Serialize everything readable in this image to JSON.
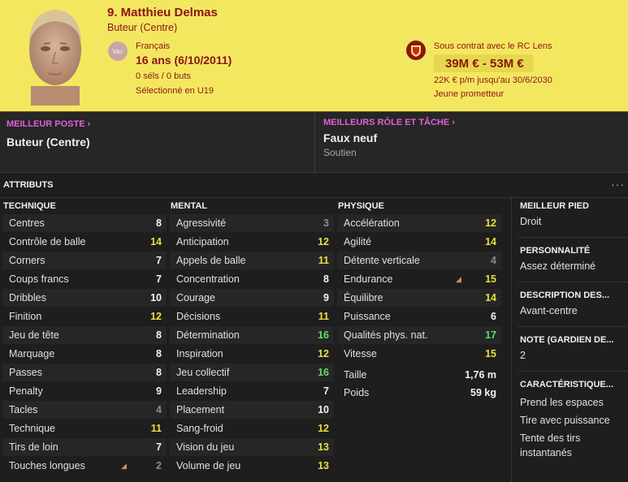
{
  "player": {
    "name": "9. Matthieu Delmas",
    "role": "Buteur (Centre)",
    "badge": "Vac",
    "nationality": "Français",
    "age": "16 ans (6/10/2011)",
    "caps": "0 séls / 0 buts",
    "youth": "Sélectionné en U19",
    "contract": "Sous contrat avec le RC Lens",
    "value": "39M € - 53M €",
    "wage": "22K € p/m jusqu'au 30/6/2030",
    "tag": "Jeune prometteur"
  },
  "best": {
    "pos_label": "MEILLEUR POSTE",
    "pos_value": "Buteur (Centre)",
    "role_label": "MEILLEURS RÔLE ET TÂCHE",
    "role_value": "Faux neuf",
    "role_duty": "Soutien"
  },
  "attributes": {
    "title": "ATTRIBUTS",
    "more": "···",
    "technique": {
      "header": "TECHNIQUE",
      "rows": [
        {
          "label": "Centres",
          "value": "8"
        },
        {
          "label": "Contrôle de balle",
          "value": "14"
        },
        {
          "label": "Corners",
          "value": "7"
        },
        {
          "label": "Coups francs",
          "value": "7"
        },
        {
          "label": "Dribbles",
          "value": "10"
        },
        {
          "label": "Finition",
          "value": "12"
        },
        {
          "label": "Jeu de tête",
          "value": "8"
        },
        {
          "label": "Marquage",
          "value": "8"
        },
        {
          "label": "Passes",
          "value": "8"
        },
        {
          "label": "Penalty",
          "value": "9"
        },
        {
          "label": "Tacles",
          "value": "4"
        },
        {
          "label": "Technique",
          "value": "11"
        },
        {
          "label": "Tirs de loin",
          "value": "7"
        },
        {
          "label": "Touches longues",
          "value": "2"
        }
      ]
    },
    "mental": {
      "header": "MENTAL",
      "rows": [
        {
          "label": "Agressivité",
          "value": "3"
        },
        {
          "label": "Anticipation",
          "value": "12"
        },
        {
          "label": "Appels de balle",
          "value": "11"
        },
        {
          "label": "Concentration",
          "value": "8"
        },
        {
          "label": "Courage",
          "value": "9"
        },
        {
          "label": "Décisions",
          "value": "11"
        },
        {
          "label": "Détermination",
          "value": "16"
        },
        {
          "label": "Inspiration",
          "value": "12"
        },
        {
          "label": "Jeu collectif",
          "value": "16"
        },
        {
          "label": "Leadership",
          "value": "7"
        },
        {
          "label": "Placement",
          "value": "10"
        },
        {
          "label": "Sang-froid",
          "value": "12"
        },
        {
          "label": "Vision du jeu",
          "value": "13"
        },
        {
          "label": "Volume de jeu",
          "value": "13"
        }
      ]
    },
    "physique": {
      "header": "PHYSIQUE",
      "rows": [
        {
          "label": "Accélération",
          "value": "12"
        },
        {
          "label": "Agilité",
          "value": "14"
        },
        {
          "label": "Détente verticale",
          "value": "4"
        },
        {
          "label": "Endurance",
          "value": "15"
        },
        {
          "label": "Équilibre",
          "value": "14"
        },
        {
          "label": "Puissance",
          "value": "6"
        },
        {
          "label": "Qualités phys. nat.",
          "value": "17"
        },
        {
          "label": "Vitesse",
          "value": "15"
        }
      ],
      "height_label": "Taille",
      "height_value": "1,76 m",
      "weight_label": "Poids",
      "weight_value": "59 kg"
    }
  },
  "side": {
    "foot_label": "MEILLEUR PIED",
    "foot_value": "Droit",
    "personality_label": "PERSONNALITÉ",
    "personality_value": "Assez déterminé",
    "desc_label": "DESCRIPTION DES...",
    "desc_value": "Avant-centre",
    "gk_label": "NOTE (GARDIEN DE...",
    "gk_value": "2",
    "traits_label": "CARACTÉRISTIQUE...",
    "trait1": "Prend les espaces",
    "trait2": "Tire avec puissance",
    "trait3a": "Tente des tirs",
    "trait3b": "instantanés"
  },
  "colors": {
    "header_bg": "#f4e760",
    "header_text": "#8b1414",
    "accent_label": "#e05fd8",
    "attr_gray": "#8c8c8c",
    "attr_white": "#f2f2f2",
    "attr_yellow": "#e4e23a",
    "attr_green": "#5fe05f",
    "trend_arrow": "#e0903a"
  }
}
